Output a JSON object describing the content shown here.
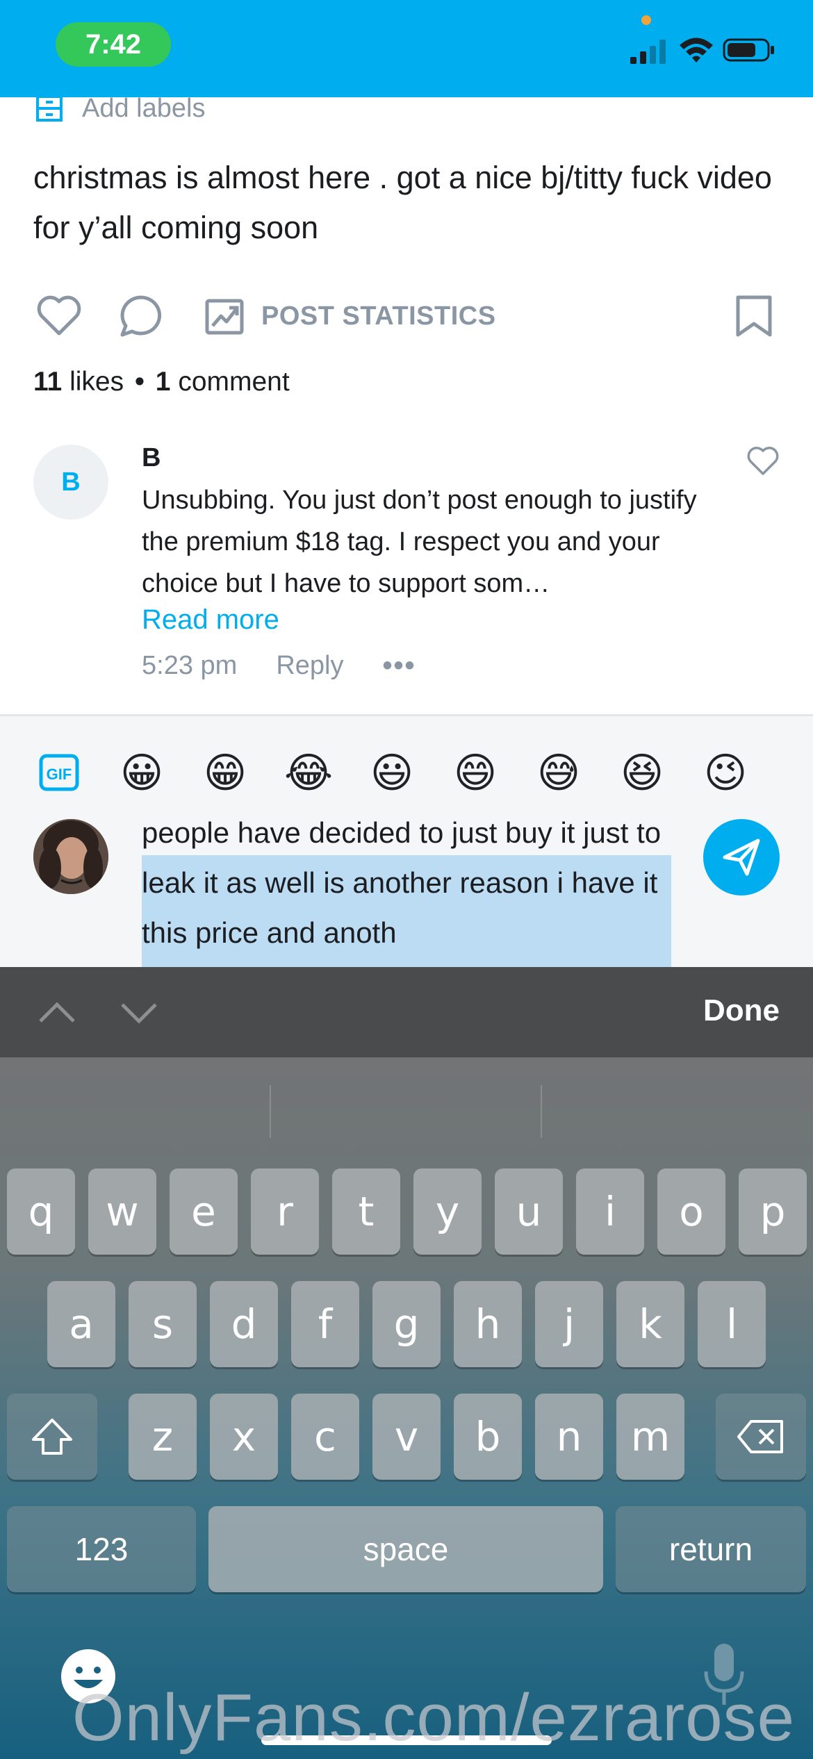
{
  "status_bar": {
    "time": "7:42"
  },
  "post": {
    "add_labels": "Add labels",
    "text": "christmas is almost here . got a nice bj/titty fuck video for y’all coming soon",
    "post_statistics": "POST STATISTICS",
    "likes_count": "11",
    "likes_label": "likes",
    "comments_count": "1",
    "comments_label": "comment"
  },
  "comment": {
    "avatar_initial": "B",
    "author": "B",
    "text": "Unsubbing. You just don’t post enough to justify the premium $18 tag. I respect you and your choice but I have to support som…",
    "read_more": "Read more",
    "time": "5:23 pm",
    "reply": "Reply",
    "more": "•••"
  },
  "composer": {
    "gif_label": "GIF",
    "emojis": [
      "😀",
      "😁",
      "😂",
      "😃",
      "😄",
      "😅",
      "😆",
      "😉"
    ],
    "typed_text": "people have decided to just buy it just to leak it as well is another reason i have it this price and anoth",
    "selection_color": "#bcdcf4"
  },
  "keyboard": {
    "done": "Done",
    "row1": [
      "q",
      "w",
      "e",
      "r",
      "t",
      "y",
      "u",
      "i",
      "o",
      "p"
    ],
    "row2": [
      "a",
      "s",
      "d",
      "f",
      "g",
      "h",
      "j",
      "k",
      "l"
    ],
    "row3": [
      "z",
      "x",
      "c",
      "v",
      "b",
      "n",
      "m"
    ],
    "numbers": "123",
    "space": "space",
    "return": "return"
  },
  "watermark": "OnlyFans.com/ezrarose",
  "colors": {
    "accent": "#00aeef",
    "status_pill": "#34c759",
    "muted": "#8a96a3"
  }
}
